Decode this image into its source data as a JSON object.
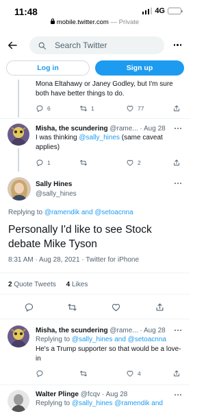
{
  "status_bar": {
    "time": "11:48",
    "network": "4G"
  },
  "browser": {
    "url": "mobile.twitter.com",
    "mode": "— Private"
  },
  "nav": {
    "search_placeholder": "Search Twitter"
  },
  "auth": {
    "login_label": "Log in",
    "signup_label": "Sign up"
  },
  "tweets": [
    {
      "text_line1": "Mona Eltahawy or Janey Godley, but I'm sure",
      "text_line2": "both have better things to do.",
      "replies": "6",
      "retweets": "1",
      "likes": "77"
    },
    {
      "name": "Misha, the scundering",
      "handle": "@rame...",
      "dot": "·",
      "date": "Aug 28",
      "text_a": "I was thinking ",
      "mention": "@sally_hines",
      "text_b": " (same caveat",
      "text_line2": "applies)",
      "replies": "1",
      "retweets": "",
      "likes": "2"
    }
  ],
  "main_tweet": {
    "name": "Sally Hines",
    "handle": "@sally_hines",
    "replying_prefix": "Replying to ",
    "replying_to": "@ramendik and @setoacnna",
    "text_line1": "Personally I'd like to see Stock",
    "text_line2": "debate Mike Tyson",
    "timestamp": "8:31 AM · Aug 28, 2021 · Twitter for iPhone",
    "quote_count": "2",
    "quote_label": " Quote Tweets",
    "like_count": "4",
    "like_label": " Likes"
  },
  "replies": [
    {
      "name": "Misha, the scundering",
      "handle": "@rame...",
      "dot": "·",
      "date": "Aug 28",
      "replying_prefix": "Replying to ",
      "replying_to": "@sally_hines and @setoacnna",
      "text_line1": "He's a Trump supporter so that would be a love-",
      "text_line2": "in",
      "replies": "",
      "retweets": "",
      "likes": "4"
    },
    {
      "name": "Walter Plinge",
      "handle": "@fcqv",
      "dot": "·",
      "date": "Aug 28",
      "replying_prefix": "Replying to ",
      "replying_to": "@sally_hines @ramendik and"
    }
  ],
  "colors": {
    "accent": "#1d9bf0",
    "text": "#0f1419",
    "secondary": "#536471",
    "divider": "#eff3f4"
  },
  "icons": [
    "back-arrow-icon",
    "search-icon",
    "more-dots-icon",
    "reply-icon",
    "retweet-icon",
    "like-icon",
    "share-icon",
    "lock-icon",
    "signal-icon",
    "battery-icon"
  ]
}
